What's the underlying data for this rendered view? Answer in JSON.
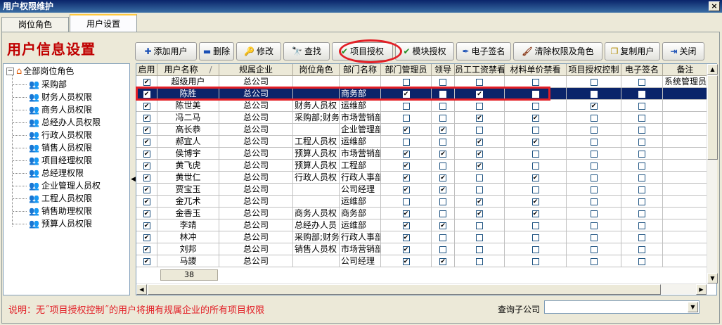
{
  "window": {
    "title": "用户权限维护",
    "close_glyph": "×"
  },
  "tabs": [
    {
      "label": "岗位角色",
      "active": false
    },
    {
      "label": "用户设置",
      "active": true
    }
  ],
  "page_title": "用户信息设置",
  "toolbar": [
    {
      "id": "add",
      "label": "添加用户",
      "icon": "plus-icon",
      "glyph": "✚",
      "color": "#1a4fb5"
    },
    {
      "id": "delete",
      "label": "删除",
      "icon": "minus-icon",
      "glyph": "▬",
      "color": "#1a4fb5"
    },
    {
      "id": "edit",
      "label": "修改",
      "icon": "key-icon",
      "glyph": "🔑",
      "color": "#b08a00"
    },
    {
      "id": "find",
      "label": "查找",
      "icon": "binoculars-icon",
      "glyph": "🔭",
      "color": "#333333"
    },
    {
      "id": "project",
      "label": "项目授权",
      "icon": "check-icon",
      "glyph": "✔",
      "color": "#1f8a1f"
    },
    {
      "id": "module",
      "label": "模块授权",
      "icon": "check-icon",
      "glyph": "✔",
      "color": "#1f8a1f"
    },
    {
      "id": "esign",
      "label": "电子签名",
      "icon": "pen-icon",
      "glyph": "✒",
      "color": "#1a4fb5"
    },
    {
      "id": "clear",
      "label": "清除权限及角色",
      "icon": "brush-icon",
      "glyph": "🖌",
      "color": "#8a3a1a"
    },
    {
      "id": "copy",
      "label": "复制用户",
      "icon": "copy-icon",
      "glyph": "❐",
      "color": "#b08a00"
    },
    {
      "id": "close",
      "label": "关闭",
      "icon": "exit-icon",
      "glyph": "⇥",
      "color": "#1a4fb5"
    }
  ],
  "tree": {
    "root": "全部岗位角色",
    "items": [
      "采购部",
      "财务人员权限",
      "商务人员权限",
      "总经办人员权限",
      "行政人员权限",
      "销售人员权限",
      "项目经理权限",
      "总经理权限",
      "企业管理人员权",
      "工程人员权限",
      "销售助理权限",
      "预算人员权限"
    ]
  },
  "grid": {
    "columns": [
      "启用",
      "用户名称",
      "规属企业",
      "岗位角色",
      "部门名称",
      "部门管理员",
      "领导",
      "员工工资禁看",
      "材料单价禁看",
      "项目授权控制",
      "电子签名",
      "备注"
    ],
    "sort_marker": "/",
    "rows": [
      {
        "enabled": true,
        "name": "超级用户",
        "company": "总公司",
        "role": "",
        "dept": "",
        "dept_admin": false,
        "leader": false,
        "salary_hide": false,
        "price_hide": false,
        "proj_ctrl": false,
        "esign": false,
        "remark": "系统管理员",
        "selected": false
      },
      {
        "enabled": true,
        "name": "陈胜",
        "company": "总公司",
        "role": "",
        "dept": "商务部",
        "dept_admin": true,
        "leader": false,
        "salary_hide": true,
        "price_hide": false,
        "proj_ctrl": false,
        "esign": false,
        "remark": "",
        "selected": true
      },
      {
        "enabled": true,
        "name": "陈世美",
        "company": "总公司",
        "role": "财务人员权",
        "dept": "运维部",
        "dept_admin": false,
        "leader": false,
        "salary_hide": false,
        "price_hide": false,
        "proj_ctrl": true,
        "esign": false,
        "remark": "",
        "selected": false
      },
      {
        "enabled": true,
        "name": "冯二马",
        "company": "总公司",
        "role": "采购部;财务",
        "dept": "市场营销部",
        "dept_admin": false,
        "leader": false,
        "salary_hide": true,
        "price_hide": true,
        "proj_ctrl": false,
        "esign": false,
        "remark": "",
        "selected": false
      },
      {
        "enabled": true,
        "name": "高长恭",
        "company": "总公司",
        "role": "",
        "dept": "企业管理部",
        "dept_admin": true,
        "leader": true,
        "salary_hide": false,
        "price_hide": false,
        "proj_ctrl": false,
        "esign": false,
        "remark": "",
        "selected": false
      },
      {
        "enabled": true,
        "name": "郝宜人",
        "company": "总公司",
        "role": "工程人员权",
        "dept": "运维部",
        "dept_admin": false,
        "leader": false,
        "salary_hide": true,
        "price_hide": true,
        "proj_ctrl": false,
        "esign": false,
        "remark": "",
        "selected": false
      },
      {
        "enabled": true,
        "name": "侯博宇",
        "company": "总公司",
        "role": "预算人员权",
        "dept": "市场营销部",
        "dept_admin": true,
        "leader": true,
        "salary_hide": true,
        "price_hide": false,
        "proj_ctrl": false,
        "esign": false,
        "remark": "",
        "selected": false
      },
      {
        "enabled": true,
        "name": "黄飞虎",
        "company": "总公司",
        "role": "预算人员权",
        "dept": "工程部",
        "dept_admin": true,
        "leader": false,
        "salary_hide": true,
        "price_hide": false,
        "proj_ctrl": false,
        "esign": false,
        "remark": "",
        "selected": false
      },
      {
        "enabled": true,
        "name": "黄世仁",
        "company": "总公司",
        "role": "行政人员权",
        "dept": "行政人事部",
        "dept_admin": true,
        "leader": true,
        "salary_hide": false,
        "price_hide": true,
        "proj_ctrl": false,
        "esign": false,
        "remark": "",
        "selected": false
      },
      {
        "enabled": true,
        "name": "贾宝玉",
        "company": "总公司",
        "role": "",
        "dept": "公司经理",
        "dept_admin": true,
        "leader": true,
        "salary_hide": false,
        "price_hide": false,
        "proj_ctrl": false,
        "esign": false,
        "remark": "",
        "selected": false
      },
      {
        "enabled": true,
        "name": "金兀术",
        "company": "总公司",
        "role": "",
        "dept": "运维部",
        "dept_admin": false,
        "leader": false,
        "salary_hide": true,
        "price_hide": true,
        "proj_ctrl": false,
        "esign": false,
        "remark": "",
        "selected": false
      },
      {
        "enabled": true,
        "name": "金香玉",
        "company": "总公司",
        "role": "商务人员权",
        "dept": "商务部",
        "dept_admin": true,
        "leader": false,
        "salary_hide": true,
        "price_hide": true,
        "proj_ctrl": false,
        "esign": false,
        "remark": "",
        "selected": false
      },
      {
        "enabled": true,
        "name": "李靖",
        "company": "总公司",
        "role": "总经办人员",
        "dept": "运维部",
        "dept_admin": true,
        "leader": true,
        "salary_hide": false,
        "price_hide": false,
        "proj_ctrl": false,
        "esign": false,
        "remark": "",
        "selected": false
      },
      {
        "enabled": true,
        "name": "林冲",
        "company": "总公司",
        "role": "采购部;财务",
        "dept": "行政人事部",
        "dept_admin": true,
        "leader": false,
        "salary_hide": false,
        "price_hide": false,
        "proj_ctrl": false,
        "esign": false,
        "remark": "",
        "selected": false
      },
      {
        "enabled": true,
        "name": "刘邦",
        "company": "总公司",
        "role": "销售人员权",
        "dept": "市场营销部",
        "dept_admin": true,
        "leader": false,
        "salary_hide": false,
        "price_hide": false,
        "proj_ctrl": false,
        "esign": false,
        "remark": "",
        "selected": false
      },
      {
        "enabled": true,
        "name": "马謖",
        "company": "总公司",
        "role": "",
        "dept": "公司经理",
        "dept_admin": true,
        "leader": true,
        "salary_hide": false,
        "price_hide": false,
        "proj_ctrl": false,
        "esign": false,
        "remark": "",
        "selected": false
      }
    ],
    "footer_count": "38"
  },
  "footer": {
    "note": "说明：无˝项目授权控制˝的用户将拥有规属企业的所有项目权限",
    "company_filter_label": "查询子公司",
    "company_filter_value": ""
  },
  "colors": {
    "highlight": "#e21f26",
    "selected_row": "#0a246a",
    "title": "#c00000"
  }
}
